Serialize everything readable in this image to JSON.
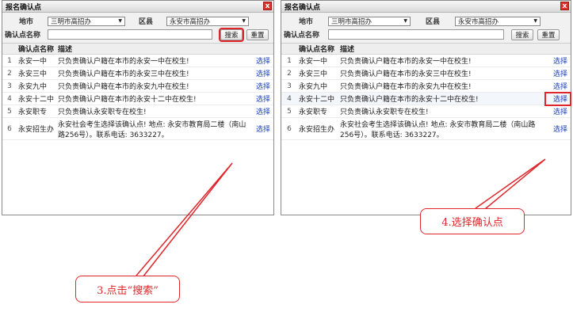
{
  "left": {
    "title": "报名确认点",
    "close": "x",
    "city_label": "地市",
    "city_value": "三明市高招办",
    "district_label": "区县",
    "district_value": "永安市高招办",
    "point_label": "确认点名称",
    "search_label": "搜索",
    "reset_label": "重置",
    "col_name": "确认点名称",
    "col_desc": "描述",
    "action": "选择",
    "rows": [
      {
        "num": "1",
        "name": "永安一中",
        "desc": "只负责确认户籍在本市的永安一中在校生!"
      },
      {
        "num": "2",
        "name": "永安三中",
        "desc": "只负责确认户籍在本市的永安三中在校生!"
      },
      {
        "num": "3",
        "name": "永安九中",
        "desc": "只负责确认户籍在本市的永安九中在校生!"
      },
      {
        "num": "4",
        "name": "永安十二中",
        "desc": "只负责确认户籍在本市的永安十二中在校生!"
      },
      {
        "num": "5",
        "name": "永安职专",
        "desc": "只负责确认永安职专在校生!"
      },
      {
        "num": "6",
        "name": "永安招生办",
        "desc": "永安社会考生选择该确认点! 地点: 永安市教育局二楼（南山路256号）。联系电话: 3633227。"
      }
    ]
  },
  "right": {
    "title": "报名确认点",
    "close": "x",
    "city_label": "地市",
    "city_value": "三明市高招办",
    "district_label": "区县",
    "district_value": "永安市高招办",
    "point_label": "确认点名称",
    "search_label": "搜索",
    "reset_label": "重置",
    "col_name": "确认点名称",
    "col_desc": "描述",
    "action": "选择",
    "rows": [
      {
        "num": "1",
        "name": "永安一中",
        "desc": "只负责确认户籍在本市的永安一中在校生!"
      },
      {
        "num": "2",
        "name": "永安三中",
        "desc": "只负责确认户籍在本市的永安三中在校生!"
      },
      {
        "num": "3",
        "name": "永安九中",
        "desc": "只负责确认户籍在本市的永安九中在校生!"
      },
      {
        "num": "4",
        "name": "永安十二中",
        "desc": "只负责确认户籍在本市的永安十二中在校生!"
      },
      {
        "num": "5",
        "name": "永安职专",
        "desc": "只负责确认永安职专在校生!"
      },
      {
        "num": "6",
        "name": "永安招生办",
        "desc": "永安社会考生选择该确认点! 地点: 永安市教育局二楼（南山路256号）。联系电话: 3633227。"
      }
    ]
  },
  "callouts": {
    "step3": "3.点击“搜索”",
    "step4": "4.选择确认点"
  },
  "colors": {
    "highlight": "#e0262a",
    "link": "#1a3fb5"
  }
}
